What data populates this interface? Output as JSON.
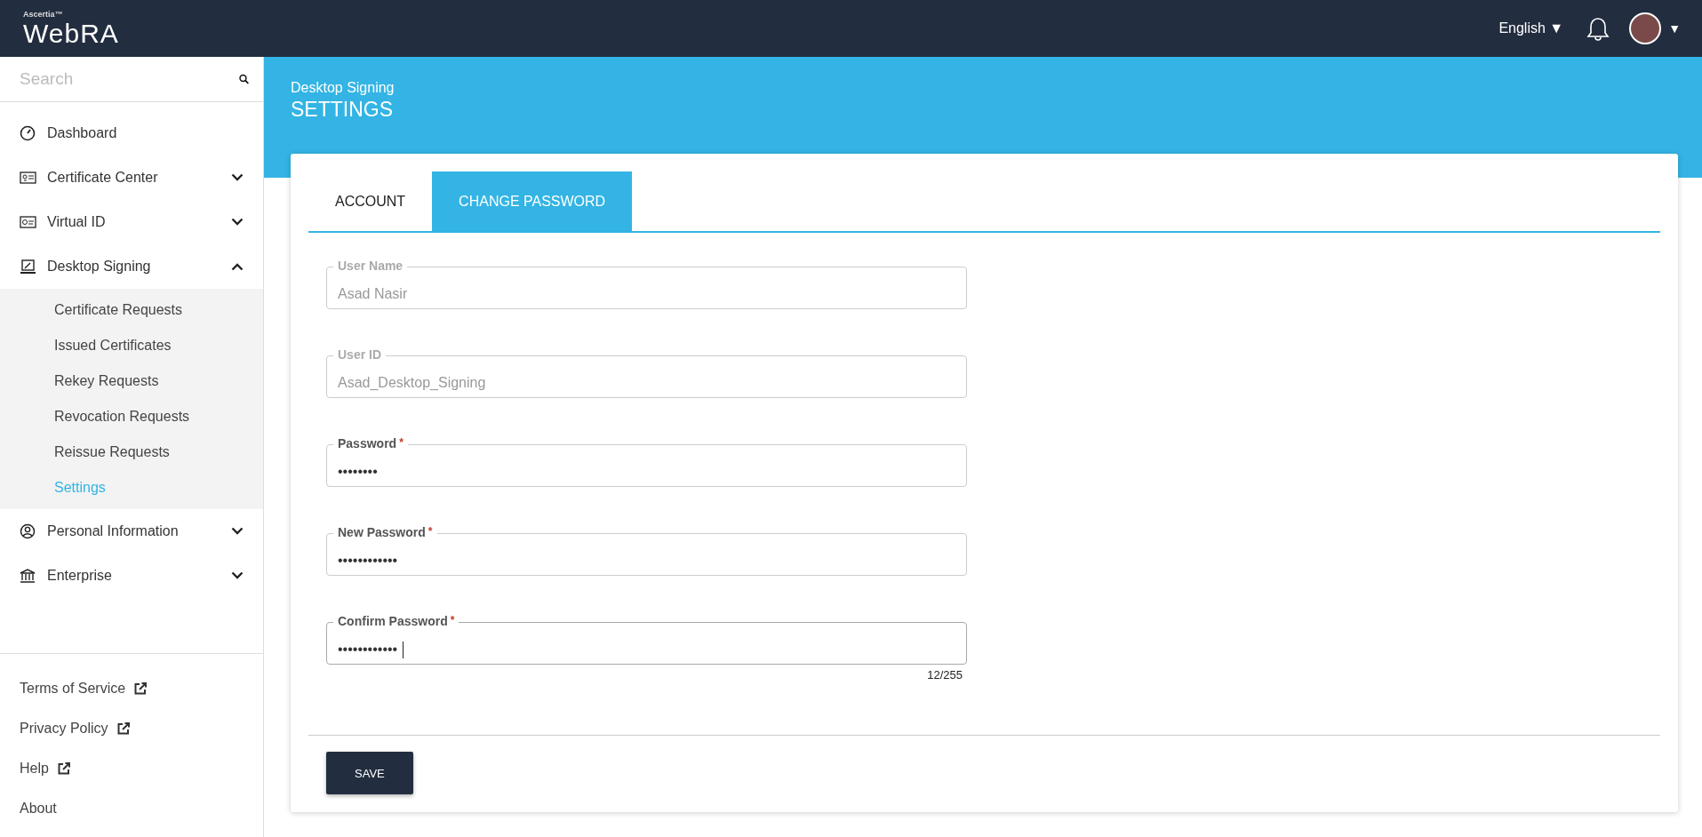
{
  "header": {
    "brand_small": "Ascertia™",
    "brand": "WebRA",
    "language": "English ▼",
    "user_menu_caret": "▼"
  },
  "sidebar": {
    "search": {
      "placeholder": "Search"
    },
    "items": [
      {
        "label": "Dashboard",
        "kind": "link"
      },
      {
        "label": "Certificate Center",
        "kind": "group",
        "expanded": false
      },
      {
        "label": "Virtual ID",
        "kind": "group",
        "expanded": false
      },
      {
        "label": "Desktop Signing",
        "kind": "group",
        "expanded": true,
        "children": [
          {
            "label": "Certificate Requests",
            "selected": false
          },
          {
            "label": "Issued Certificates",
            "selected": false
          },
          {
            "label": "Rekey Requests",
            "selected": false
          },
          {
            "label": "Revocation Requests",
            "selected": false
          },
          {
            "label": "Reissue Requests",
            "selected": false
          },
          {
            "label": "Settings",
            "selected": true
          }
        ]
      },
      {
        "label": "Personal Information",
        "kind": "group",
        "expanded": false
      },
      {
        "label": "Enterprise",
        "kind": "group",
        "expanded": false
      }
    ],
    "footer_links": [
      {
        "label": "Terms of Service",
        "external": true
      },
      {
        "label": "Privacy Policy",
        "external": true
      },
      {
        "label": "Help",
        "external": true
      },
      {
        "label": "About"
      }
    ]
  },
  "banner": {
    "breadcrumb": "Desktop Signing",
    "title": "SETTINGS"
  },
  "tabs": [
    {
      "label": "ACCOUNT",
      "selected": false
    },
    {
      "label": "CHANGE PASSWORD",
      "selected": true
    }
  ],
  "fields": [
    {
      "label": "User Name",
      "value": "Asad Nasir",
      "disabled": true,
      "focused": false
    },
    {
      "label": "User ID",
      "value": "Asad_Desktop_Signing",
      "disabled": true,
      "focused": false
    },
    {
      "label": "Password",
      "value": "••••••••",
      "required": true,
      "disabled": false,
      "focused": false
    },
    {
      "label": "New Password",
      "value": "••••••••••••",
      "required": true,
      "disabled": false,
      "focused": false
    },
    {
      "label": "Confirm Password",
      "value": "••••••••••••",
      "required": true,
      "disabled": false,
      "focused": true,
      "counter": "12/255"
    }
  ],
  "required_mark": "*",
  "save_button": "SAVE"
}
